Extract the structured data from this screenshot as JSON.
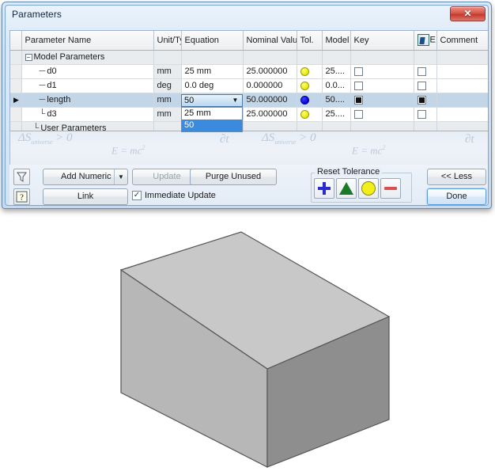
{
  "window": {
    "title": "Parameters",
    "close_label": "✕"
  },
  "table": {
    "columns": [
      {
        "key": "sel",
        "label": ""
      },
      {
        "key": "name",
        "label": "Parameter Name"
      },
      {
        "key": "unit",
        "label": "Unit/Ty"
      },
      {
        "key": "equation",
        "label": "Equation"
      },
      {
        "key": "nominal",
        "label": "Nominal Valu"
      },
      {
        "key": "tol",
        "label": "Tol."
      },
      {
        "key": "model",
        "label": "Model"
      },
      {
        "key": "key",
        "label": "Key"
      },
      {
        "key": "export",
        "label": "E"
      },
      {
        "key": "comment",
        "label": "Comment"
      }
    ],
    "export_icon": "spreadsheet-export-icon",
    "groups": [
      {
        "label": "Model Parameters",
        "expanded": true
      },
      {
        "label": "User Parameters",
        "expanded": true
      }
    ],
    "rows": [
      {
        "selected": false,
        "name": "d0",
        "unit": "mm",
        "equation": "25 mm",
        "nominal": "25.000000",
        "tol": "yellow",
        "model": "25....",
        "key_checked": false,
        "export_checked": false,
        "comment": ""
      },
      {
        "selected": false,
        "name": "d1",
        "unit": "deg",
        "equation": "0.0 deg",
        "nominal": "0.000000",
        "tol": "yellow",
        "model": "0.0...",
        "key_checked": false,
        "export_checked": false,
        "comment": ""
      },
      {
        "selected": true,
        "name": "length",
        "unit": "mm",
        "equation": "50",
        "nominal": "50.000000",
        "tol": "blue",
        "model": "50....",
        "key_checked": true,
        "export_checked": true,
        "comment": ""
      },
      {
        "selected": false,
        "name": "d3",
        "unit": "mm",
        "equation": "25 mm",
        "nominal": "25.000000",
        "tol": "yellow",
        "model": "25....",
        "key_checked": false,
        "export_checked": false,
        "comment": ""
      }
    ]
  },
  "dropdown": {
    "value": "50",
    "arrow": "▼",
    "options": [
      "25 mm",
      "50"
    ],
    "selected_option": "50"
  },
  "toolbar": {
    "filter_icon": "filter-funnel-icon",
    "help_icon": "help-question-icon",
    "add_numeric_label": "Add Numeric",
    "add_numeric_arrow": "▼",
    "update_label": "Update",
    "purge_label": "Purge Unused",
    "link_label": "Link",
    "immediate_update_label": "Immediate Update",
    "immediate_update_checked": true,
    "checkmark": "✓",
    "reset_tolerance_label": "Reset Tolerance",
    "tolerance_buttons": [
      {
        "name": "plus-tolerance-icon",
        "color": "#2b2bd0"
      },
      {
        "name": "triangle-tolerance-icon",
        "color": "#1a7a28"
      },
      {
        "name": "circle-tolerance-icon",
        "color": "#f2ee1c"
      },
      {
        "name": "minus-tolerance-icon",
        "color": "#d85050"
      }
    ],
    "less_label": "<< Less",
    "done_label": "Done"
  },
  "wallpaper": {
    "equations": [
      "ΔS",
      "universe",
      "> 0",
      "∂t",
      "E = mc",
      "2"
    ]
  },
  "model_view": {
    "shape": "rectangular-box",
    "faces": {
      "top": "#c8c8c8",
      "front": "#b8b8b8",
      "right": "#8e8e8e"
    },
    "outline": "#555555"
  },
  "colors": {
    "accent": "#3a8ae0",
    "title_bar": "#cfe0f2",
    "selection": "#c3d6e8",
    "close_red": "#c33a2e"
  }
}
